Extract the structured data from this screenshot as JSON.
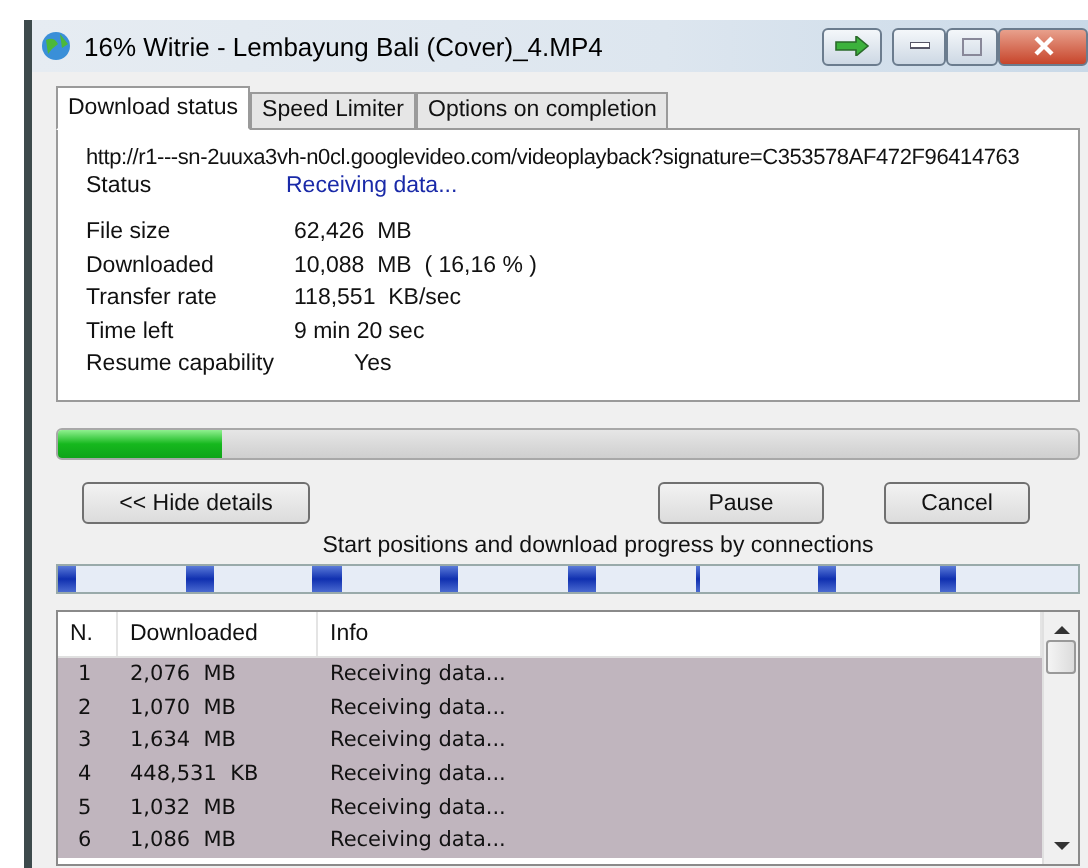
{
  "window": {
    "title": "16% Witrie - Lembayung Bali (Cover)_4.MP4"
  },
  "tabs": [
    {
      "label": "Download status",
      "selected": true
    },
    {
      "label": "Speed Limiter",
      "selected": false
    },
    {
      "label": "Options on completion",
      "selected": false
    }
  ],
  "details": {
    "url": "http://r1---sn-2uuxa3vh-n0cl.googlevideo.com/videoplayback?signature=C353578AF472F96414763",
    "status": {
      "label": "Status",
      "value": "Receiving data..."
    },
    "fields": [
      {
        "label": "File size",
        "value": "62,426  MB"
      },
      {
        "label": "Downloaded",
        "value": "10,088  MB  ( 16,16 % )"
      },
      {
        "label": "Transfer rate",
        "value": "118,551  KB/sec"
      },
      {
        "label": "Time left",
        "value": "9 min 20 sec"
      },
      {
        "label": "Resume capability",
        "value": "Yes",
        "indent": true
      }
    ]
  },
  "progress": {
    "level": 0.16
  },
  "buttons": {
    "hide": "<< Hide details",
    "pause": "Pause",
    "cancel": "Cancel"
  },
  "connections_caption": "Start positions and download progress by connections",
  "table": {
    "columns": [
      "N.",
      "Downloaded",
      "Info"
    ],
    "rows": [
      {
        "n": "1",
        "downloaded": "2,076  MB",
        "info": "Receiving data...",
        "selected": true
      },
      {
        "n": "2",
        "downloaded": "1,070  MB",
        "info": "Receiving data...",
        "selected": true
      },
      {
        "n": "3",
        "downloaded": "1,634  MB",
        "info": "Receiving data...",
        "selected": true
      },
      {
        "n": "4",
        "downloaded": "448,531  KB",
        "info": "Receiving data...",
        "selected": true
      },
      {
        "n": "5",
        "downloaded": "1,032  MB",
        "info": "Receiving data...",
        "selected": true
      },
      {
        "n": "6",
        "downloaded": "1,086  MB",
        "info": "Receiving data...",
        "selected": true
      }
    ]
  }
}
